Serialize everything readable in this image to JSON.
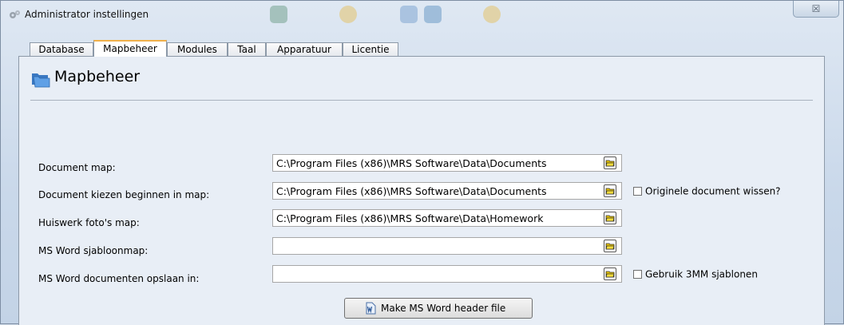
{
  "window": {
    "title": "Administrator instellingen",
    "close_glyph": "☒"
  },
  "tabs": [
    {
      "label": "Database",
      "active": false
    },
    {
      "label": "Mapbeheer",
      "active": true
    },
    {
      "label": "Modules",
      "active": false
    },
    {
      "label": "Taal",
      "active": false
    },
    {
      "label": "Apparatuur",
      "active": false
    },
    {
      "label": "Licentie",
      "active": false
    }
  ],
  "page": {
    "title": "Mapbeheer",
    "icon": "folders-icon"
  },
  "fields": [
    {
      "label": "Document map:",
      "value": "C:\\Program Files (x86)\\MRS Software\\Data\\Documents"
    },
    {
      "label": "Document kiezen beginnen in map:",
      "value": "C:\\Program Files (x86)\\MRS Software\\Data\\Documents"
    },
    {
      "label": "Huiswerk foto's map:",
      "value": "C:\\Program Files (x86)\\MRS Software\\Data\\Homework"
    },
    {
      "label": "MS Word sjabloonmap:",
      "value": ""
    },
    {
      "label": "MS Word documenten opslaan in:",
      "value": ""
    }
  ],
  "checkboxes": {
    "delete_original": {
      "label": "Originele document wissen?",
      "checked": false
    },
    "use_3mm_templates": {
      "label": "Gebruik 3MM sjablonen",
      "checked": false
    }
  },
  "button": {
    "label": "Make MS Word header file",
    "icon": "word-document-icon"
  },
  "colors": {
    "active_tab_accent": "#f0b04a",
    "panel_background": "#e8eef6"
  }
}
